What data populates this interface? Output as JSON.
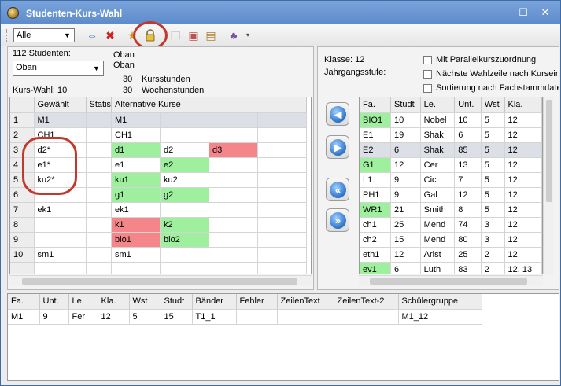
{
  "window": {
    "title": "Studenten-Kurs-Wahl",
    "controls": {
      "minimize": "—",
      "maximize": "☐",
      "close": "✕"
    }
  },
  "toolbar": {
    "filter_value": "Alle",
    "icons": [
      "swap-icon",
      "delete-icon",
      "folder-star-icon",
      "lock-icon",
      "copy-icon",
      "delete-copy-icon",
      "stack-icon",
      "users-icon"
    ]
  },
  "left": {
    "student_count": "112 Studenten:",
    "student_value": "Oban",
    "name1": "Oban",
    "name2": "Oban",
    "kurswahl": "Kurs-Wahl: 10",
    "kursstunden_num": "30",
    "kursstunden_label": "Kursstunden",
    "wochenstunden_num": "30",
    "wochenstunden_label": "Wochenstunden",
    "columns": [
      "",
      "Gewählt",
      "Statis",
      "Alternative Kurse",
      "",
      "",
      ""
    ],
    "rows": [
      {
        "n": "1",
        "g": "M1",
        "s": "",
        "a": [
          {
            "t": "M1",
            "c": ""
          },
          {
            "t": "",
            "c": ""
          },
          {
            "t": "",
            "c": ""
          },
          {
            "t": "",
            "c": ""
          }
        ]
      },
      {
        "n": "2",
        "g": "CH1",
        "s": "",
        "a": [
          {
            "t": "CH1",
            "c": ""
          },
          {
            "t": "",
            "c": ""
          },
          {
            "t": "",
            "c": ""
          },
          {
            "t": "",
            "c": ""
          }
        ]
      },
      {
        "n": "3",
        "g": "d2*",
        "s": "",
        "a": [
          {
            "t": "d1",
            "c": "green"
          },
          {
            "t": "d2",
            "c": ""
          },
          {
            "t": "d3",
            "c": "red"
          },
          {
            "t": "",
            "c": ""
          }
        ]
      },
      {
        "n": "4",
        "g": "e1*",
        "s": "",
        "a": [
          {
            "t": "e1",
            "c": ""
          },
          {
            "t": "e2",
            "c": "green"
          },
          {
            "t": "",
            "c": ""
          },
          {
            "t": "",
            "c": ""
          }
        ]
      },
      {
        "n": "5",
        "g": "ku2*",
        "s": "",
        "a": [
          {
            "t": "ku1",
            "c": "green"
          },
          {
            "t": "ku2",
            "c": ""
          },
          {
            "t": "",
            "c": ""
          },
          {
            "t": "",
            "c": ""
          }
        ]
      },
      {
        "n": "6",
        "g": "",
        "s": "",
        "a": [
          {
            "t": "g1",
            "c": "green"
          },
          {
            "t": "g2",
            "c": "green"
          },
          {
            "t": "",
            "c": ""
          },
          {
            "t": "",
            "c": ""
          }
        ]
      },
      {
        "n": "7",
        "g": "ek1",
        "s": "",
        "a": [
          {
            "t": "ek1",
            "c": ""
          },
          {
            "t": "",
            "c": ""
          },
          {
            "t": "",
            "c": ""
          },
          {
            "t": "",
            "c": ""
          }
        ]
      },
      {
        "n": "8",
        "g": "",
        "s": "",
        "a": [
          {
            "t": "k1",
            "c": "red"
          },
          {
            "t": "k2",
            "c": "green"
          },
          {
            "t": "",
            "c": ""
          },
          {
            "t": "",
            "c": ""
          }
        ]
      },
      {
        "n": "9",
        "g": "",
        "s": "",
        "a": [
          {
            "t": "bio1",
            "c": "red"
          },
          {
            "t": "bio2",
            "c": "green"
          },
          {
            "t": "",
            "c": ""
          },
          {
            "t": "",
            "c": ""
          }
        ]
      },
      {
        "n": "10",
        "g": "sm1",
        "s": "",
        "a": [
          {
            "t": "sm1",
            "c": ""
          },
          {
            "t": "",
            "c": ""
          },
          {
            "t": "",
            "c": ""
          },
          {
            "t": "",
            "c": ""
          }
        ]
      },
      {
        "n": "",
        "g": "",
        "s": "",
        "a": [
          {
            "t": "",
            "c": ""
          },
          {
            "t": "",
            "c": ""
          },
          {
            "t": "",
            "c": ""
          },
          {
            "t": "",
            "c": ""
          }
        ]
      }
    ]
  },
  "right": {
    "klasse": "Klasse: 12",
    "jahrgangsstufe": "Jahrgangsstufe:",
    "options": [
      "Mit Parallelkurszuordnung",
      "Nächste Wahlzeile nach Kurseir",
      "Sortierung nach Fachstammdate"
    ],
    "columns": [
      "Fa.",
      "Studt",
      "Le.",
      "Unt.",
      "Wst",
      "Kla."
    ],
    "rows": [
      {
        "fa": "BIO1",
        "studt": "10",
        "le": "Nobel",
        "unt": "10",
        "wst": "5",
        "kla": "12",
        "green": true
      },
      {
        "fa": "E1",
        "studt": "19",
        "le": "Shak",
        "unt": "6",
        "wst": "5",
        "kla": "12",
        "green": false
      },
      {
        "fa": "E2",
        "studt": "6",
        "le": "Shak",
        "unt": "85",
        "wst": "5",
        "kla": "12",
        "green": false,
        "sel": true
      },
      {
        "fa": "G1",
        "studt": "12",
        "le": "Cer",
        "unt": "13",
        "wst": "5",
        "kla": "12",
        "green": true
      },
      {
        "fa": "L1",
        "studt": "9",
        "le": "Cic",
        "unt": "7",
        "wst": "5",
        "kla": "12",
        "green": false
      },
      {
        "fa": "PH1",
        "studt": "9",
        "le": "Gal",
        "unt": "12",
        "wst": "5",
        "kla": "12",
        "green": false
      },
      {
        "fa": "WR1",
        "studt": "21",
        "le": "Smith",
        "unt": "8",
        "wst": "5",
        "kla": "12",
        "green": true
      },
      {
        "fa": "ch1",
        "studt": "25",
        "le": "Mend",
        "unt": "74",
        "wst": "3",
        "kla": "12",
        "green": false
      },
      {
        "fa": "ch2",
        "studt": "15",
        "le": "Mend",
        "unt": "80",
        "wst": "3",
        "kla": "12",
        "green": false
      },
      {
        "fa": "eth1",
        "studt": "12",
        "le": "Arist",
        "unt": "25",
        "wst": "2",
        "kla": "12",
        "green": false
      },
      {
        "fa": "ev1",
        "studt": "6",
        "le": "Luth",
        "unt": "83",
        "wst": "2",
        "kla": "12, 13",
        "green": true
      }
    ]
  },
  "bottom": {
    "columns": [
      "Fa.",
      "Unt.",
      "Le.",
      "Kla.",
      "Wst",
      "Studt",
      "Bänder",
      "Fehler",
      "ZeilenText",
      "ZeilenText-2",
      "Schülergruppe"
    ],
    "row": [
      "M1",
      "9",
      "Fer",
      "12",
      "5",
      "15",
      "T1_1",
      "",
      "",
      "",
      "M1_12"
    ]
  }
}
